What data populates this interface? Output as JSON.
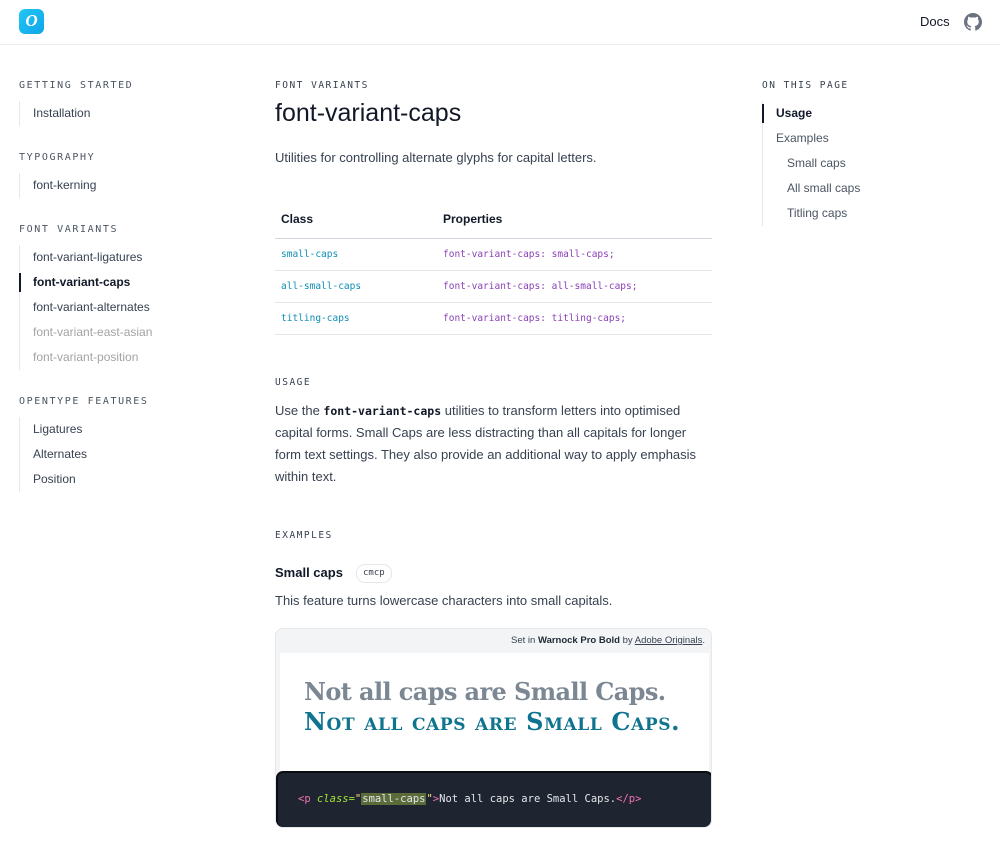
{
  "header": {
    "logo_glyph": "O",
    "docs_label": "Docs",
    "github_icon": "github-icon"
  },
  "sidebar": {
    "sections": [
      {
        "title": "GETTING STARTED",
        "items": [
          {
            "label": "Installation"
          }
        ]
      },
      {
        "title": "TYPOGRAPHY",
        "items": [
          {
            "label": "font-kerning"
          }
        ]
      },
      {
        "title": "FONT VARIANTS",
        "items": [
          {
            "label": "font-variant-ligatures"
          },
          {
            "label": "font-variant-caps",
            "active": true
          },
          {
            "label": "font-variant-alternates"
          },
          {
            "label": "font-variant-east-asian",
            "muted": true
          },
          {
            "label": "font-variant-position",
            "muted": true
          }
        ]
      },
      {
        "title": "OPENTYPE FEATURES",
        "items": [
          {
            "label": "Ligatures"
          },
          {
            "label": "Alternates"
          },
          {
            "label": "Position"
          }
        ]
      }
    ]
  },
  "main": {
    "eyebrow": "FONT VARIANTS",
    "title": "font-variant-caps",
    "lead": "Utilities for controlling alternate glyphs for capital letters.",
    "table": {
      "headers": [
        "Class",
        "Properties"
      ],
      "rows": [
        {
          "cls": "small-caps",
          "prop": "font-variant-caps: small-caps;"
        },
        {
          "cls": "all-small-caps",
          "prop": "font-variant-caps: all-small-caps;"
        },
        {
          "cls": "titling-caps",
          "prop": "font-variant-caps: titling-caps;"
        }
      ]
    },
    "usage": {
      "heading": "USAGE",
      "text_before": "Use the ",
      "code": "font-variant-caps",
      "text_after": " utilities to transform letters into optimised capital forms. Small Caps are less distracting than all capitals for longer form text settings. They also provide an additional way to apply emphasis within text."
    },
    "examples": {
      "heading": "EXAMPLES",
      "title": "Small caps",
      "tag": "cmcp",
      "description": "This feature turns lowercase characters into small capitals.",
      "credit_prefix": "Set in ",
      "credit_font": "Warnock Pro Bold",
      "credit_by": " by ",
      "credit_link": "Adobe Originals",
      "credit_suffix": ".",
      "specimen_plain": "Not all caps are Small Caps.",
      "specimen_smallcaps": "Not all caps are Small Caps.",
      "code": {
        "open_tag": "<p",
        "attr": " class=",
        "quote_open": "\"",
        "value": "small-caps",
        "quote_close": "\"",
        "gt": ">",
        "text": "Not all caps are Small Caps.",
        "close_tag": "</p>"
      }
    }
  },
  "toc": {
    "heading": "ON THIS PAGE",
    "items": [
      {
        "label": "Usage",
        "active": true,
        "level": 1
      },
      {
        "label": "Examples",
        "level": 1
      },
      {
        "label": "Small caps",
        "level": 2
      },
      {
        "label": "All small caps",
        "level": 2
      },
      {
        "label": "Titling caps",
        "level": 2
      }
    ]
  },
  "colors": {
    "logo": "#0ea5e9",
    "class_text": "#0e8fb5",
    "property_text": "#8b3fb8",
    "code_bg": "#1e2430",
    "specimen_accent": "#0e7490"
  }
}
